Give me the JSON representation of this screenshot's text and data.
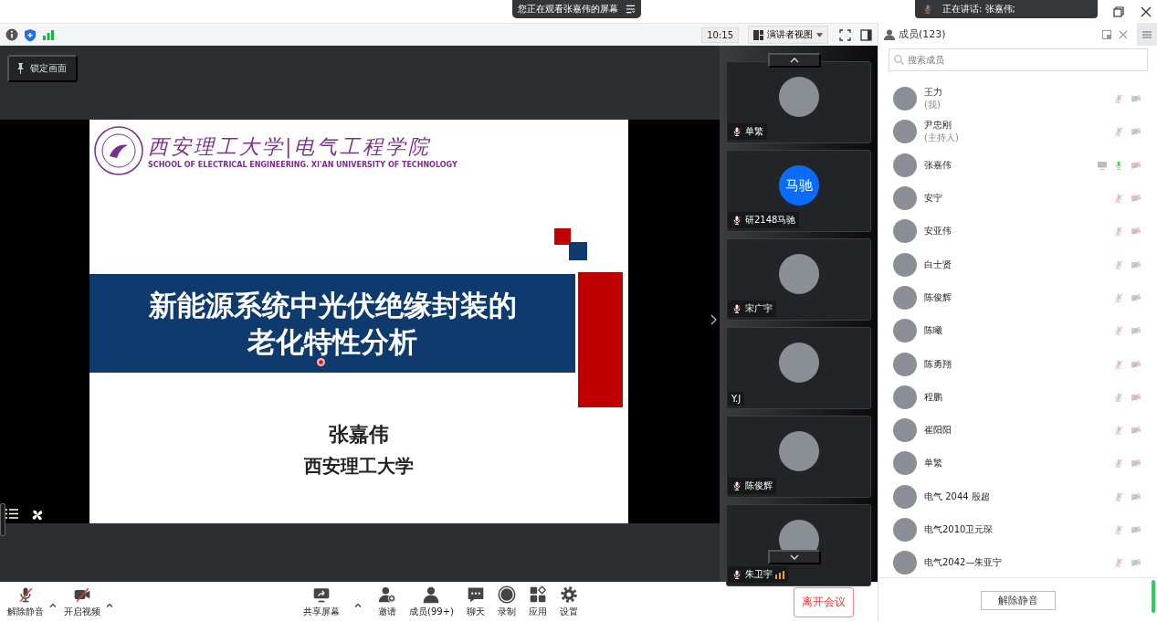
{
  "title_bar": {
    "banner": "您正在观看张嘉伟的屏幕",
    "speaking": "正在讲话: 张嘉伟;"
  },
  "toolbar": {
    "time": "10:15",
    "view_mode": "演讲者视图"
  },
  "stage": {
    "lock_label": "锁定画面"
  },
  "slide": {
    "logo_text": "西安理工大学|电气工程学院",
    "logo_subtitle": "SCHOOL OF ELECTRICAL ENGINEERING. XI'AN UNIVERSITY OF TECHNOLOGY",
    "title_lines": [
      "新能源系统中光伏绝缘封装的",
      "老化特性分析"
    ],
    "author": "张嘉伟",
    "affiliation": "西安理工大学"
  },
  "video_tiles": [
    {
      "name": "单繁",
      "muted": true,
      "speaking": false,
      "kind": "photo"
    },
    {
      "name": "研2148马驰",
      "muted": true,
      "speaking": false,
      "kind": "initials",
      "initials": "马驰"
    },
    {
      "name": "宋广宇",
      "muted": true,
      "speaking": false,
      "kind": "photo"
    },
    {
      "name": "Y.J",
      "muted": false,
      "speaking": false,
      "kind": "photo"
    },
    {
      "name": "陈俊辉",
      "muted": true,
      "speaking": false,
      "kind": "photo"
    },
    {
      "name": "朱卫宇",
      "muted": true,
      "speaking": true,
      "kind": "photo"
    }
  ],
  "members_panel": {
    "title": "成员(123)",
    "search": {
      "placeholder": "搜索成员"
    },
    "members": [
      {
        "name": "王力",
        "role": "(我)",
        "muted": true,
        "sharing": false,
        "video_on": false
      },
      {
        "name": "尹忠刚",
        "role": "(主持人)",
        "muted": true,
        "sharing": false,
        "video_on": false
      },
      {
        "name": "张嘉伟",
        "muted": false,
        "sharing": true,
        "video_on": false
      },
      {
        "name": "安宁",
        "muted": true,
        "sharing": false,
        "video_on": false
      },
      {
        "name": "安亚伟",
        "muted": true,
        "sharing": false,
        "video_on": false
      },
      {
        "name": "白士贤",
        "muted": true,
        "sharing": false,
        "video_on": false
      },
      {
        "name": "陈俊辉",
        "muted": true,
        "sharing": false,
        "video_on": false
      },
      {
        "name": "陈曦",
        "muted": true,
        "sharing": false,
        "video_on": false
      },
      {
        "name": "陈勇翔",
        "muted": true,
        "sharing": false,
        "video_on": false
      },
      {
        "name": "程鹏",
        "muted": true,
        "sharing": false,
        "video_on": false
      },
      {
        "name": "崔阳阳",
        "muted": true,
        "sharing": false,
        "video_on": false
      },
      {
        "name": "单繁",
        "muted": true,
        "sharing": false,
        "video_on": false
      },
      {
        "name": "电气 2044 殷超",
        "muted": true,
        "sharing": false,
        "video_on": false
      },
      {
        "name": "电气2010卫元琛",
        "muted": true,
        "sharing": false,
        "video_on": false
      },
      {
        "name": "电气2042—朱亚宁",
        "muted": true,
        "sharing": false,
        "video_on": false
      }
    ],
    "footer_button": "解除静音"
  },
  "bottom_toolbar": {
    "left": [
      {
        "label": "解除静音",
        "caret": true
      },
      {
        "label": "开启视频",
        "caret": true
      }
    ],
    "center": [
      {
        "label": "共享屏幕",
        "caret": true
      },
      {
        "label": "邀请",
        "caret": false
      },
      {
        "label": "成员(99+)",
        "caret": false
      },
      {
        "label": "聊天",
        "caret": false
      },
      {
        "label": "录制",
        "caret": false
      },
      {
        "label": "应用",
        "caret": false
      },
      {
        "label": "设置",
        "caret": false
      }
    ],
    "leave": "离开会议"
  }
}
